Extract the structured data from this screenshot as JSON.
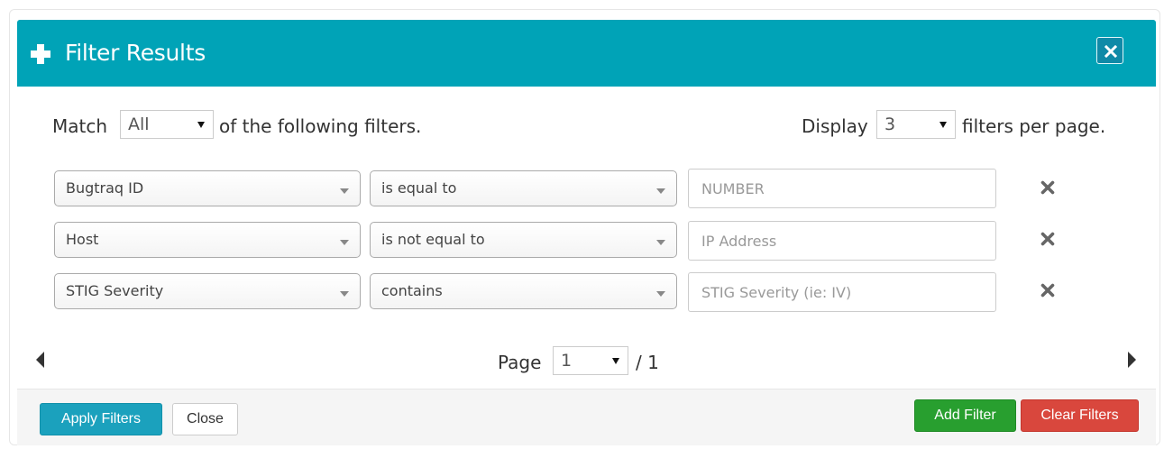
{
  "header": {
    "title": "Filter Results",
    "icon": "plus-icon",
    "close_icon": "close-icon",
    "color": "#00a3b7"
  },
  "match": {
    "prefix": "Match",
    "value": "All",
    "suffix": "of the following filters."
  },
  "display": {
    "prefix": "Display",
    "value": "3",
    "suffix": "filters per page."
  },
  "filters": [
    {
      "field": "Bugtraq ID",
      "operator": "is equal to",
      "value": "",
      "placeholder": "NUMBER"
    },
    {
      "field": "Host",
      "operator": "is not equal to",
      "value": "",
      "placeholder": "IP Address"
    },
    {
      "field": "STIG Severity",
      "operator": "contains",
      "value": "",
      "placeholder": "STIG Severity (ie: IV)"
    }
  ],
  "pagination": {
    "label": "Page",
    "current": "1",
    "total": "/ 1"
  },
  "footer": {
    "apply_label": "Apply Filters",
    "close_label": "Close",
    "add_label": "Add Filter",
    "clear_label": "Clear Filters"
  },
  "colors": {
    "apply": "#1ba1bd",
    "add": "#289f2f",
    "clear": "#d9473d"
  }
}
